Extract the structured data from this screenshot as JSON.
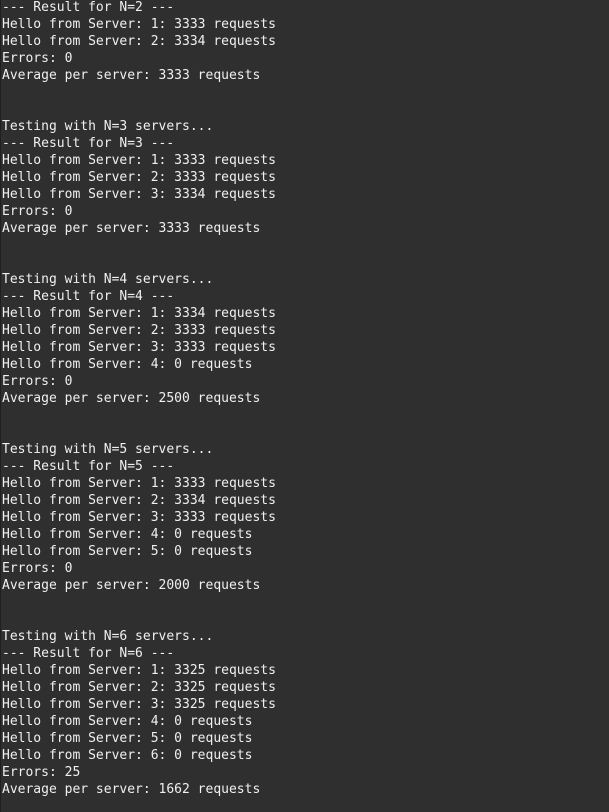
{
  "terminal": {
    "lines": [
      "--- Result for N=2 ---",
      "Hello from Server: 1: 3333 requests",
      "Hello from Server: 2: 3334 requests",
      "Errors: 0",
      "Average per server: 3333 requests",
      "",
      "",
      "Testing with N=3 servers...",
      "--- Result for N=3 ---",
      "Hello from Server: 1: 3333 requests",
      "Hello from Server: 2: 3333 requests",
      "Hello from Server: 3: 3334 requests",
      "Errors: 0",
      "Average per server: 3333 requests",
      "",
      "",
      "Testing with N=4 servers...",
      "--- Result for N=4 ---",
      "Hello from Server: 1: 3334 requests",
      "Hello from Server: 2: 3333 requests",
      "Hello from Server: 3: 3333 requests",
      "Hello from Server: 4: 0 requests",
      "Errors: 0",
      "Average per server: 2500 requests",
      "",
      "",
      "Testing with N=5 servers...",
      "--- Result for N=5 ---",
      "Hello from Server: 1: 3333 requests",
      "Hello from Server: 2: 3334 requests",
      "Hello from Server: 3: 3333 requests",
      "Hello from Server: 4: 0 requests",
      "Hello from Server: 5: 0 requests",
      "Errors: 0",
      "Average per server: 2000 requests",
      "",
      "",
      "Testing with N=6 servers...",
      "--- Result for N=6 ---",
      "Hello from Server: 1: 3325 requests",
      "Hello from Server: 2: 3325 requests",
      "Hello from Server: 3: 3325 requests",
      "Hello from Server: 4: 0 requests",
      "Hello from Server: 5: 0 requests",
      "Hello from Server: 6: 0 requests",
      "Errors: 25",
      "Average per server: 1662 requests"
    ]
  }
}
